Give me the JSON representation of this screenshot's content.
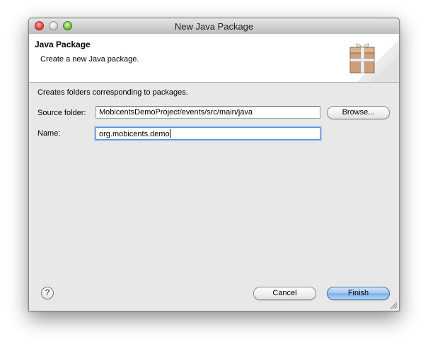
{
  "window": {
    "title": "New Java Package"
  },
  "banner": {
    "title": "Java Package",
    "description": "Create a new Java package."
  },
  "form": {
    "description": "Creates folders corresponding to packages.",
    "source_folder_label": "Source folder:",
    "source_folder_value": "MobicentsDemoProject/events/src/main/java",
    "browse_label": "Browse...",
    "name_label": "Name:",
    "name_value": "org.mobicents.demo"
  },
  "footer": {
    "help_glyph": "?",
    "cancel_label": "Cancel",
    "finish_label": "Finish"
  },
  "icons": {
    "window_controls": [
      "close-icon",
      "minimize-icon",
      "zoom-icon"
    ],
    "banner": "package-icon",
    "help": "help-icon",
    "resize": "resize-grip-icon"
  },
  "colors": {
    "accent": "#7aaee8",
    "focus_ring": "#a9c7ee"
  }
}
